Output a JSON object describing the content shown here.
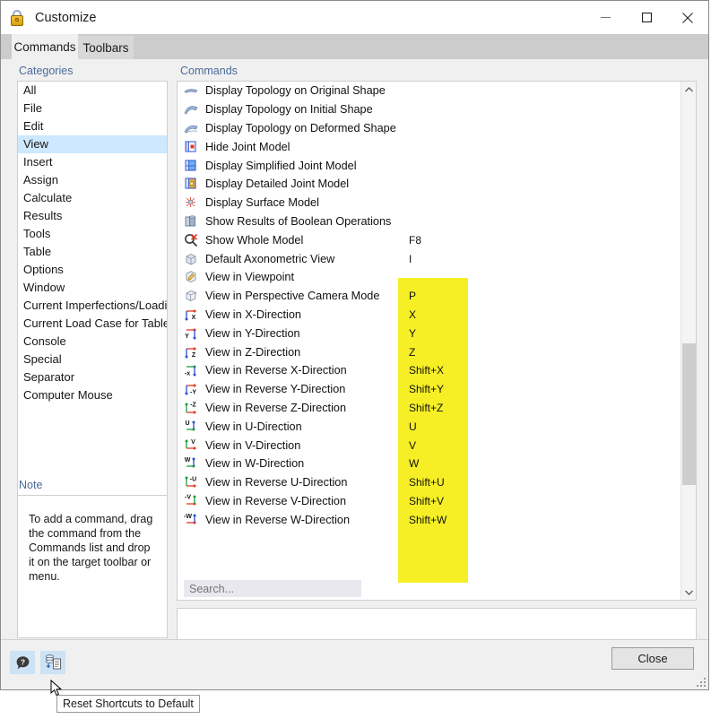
{
  "window": {
    "title": "Customize",
    "icon": "lock-icon",
    "minimize_label": "–",
    "maximize_label": "□",
    "close_label": "✕"
  },
  "tabs": [
    {
      "label": "Commands",
      "active": true
    },
    {
      "label": "Toolbars",
      "active": false
    }
  ],
  "categories": {
    "label": "Categories",
    "selected": "View",
    "items": [
      "All",
      "File",
      "Edit",
      "View",
      "Insert",
      "Assign",
      "Calculate",
      "Results",
      "Tools",
      "Table",
      "Options",
      "Window",
      "Current Imperfections/Loading",
      "Current Load Case for Tables",
      "Console",
      "Special",
      "Separator",
      "Computer Mouse"
    ]
  },
  "note": {
    "label": "Note",
    "text": "To add a command, drag the command from the Commands list and drop it on the target toolbar or menu."
  },
  "commands": {
    "label": "Commands",
    "items": [
      {
        "label": "Display Topology on Original Shape",
        "icon": "topology-original-icon",
        "shortcut": ""
      },
      {
        "label": "Display Topology on Initial Shape",
        "icon": "topology-initial-icon",
        "shortcut": ""
      },
      {
        "label": "Display Topology on Deformed Shape",
        "icon": "topology-deformed-icon",
        "shortcut": ""
      },
      {
        "label": "Hide Joint Model",
        "icon": "hide-joint-model-icon",
        "shortcut": ""
      },
      {
        "label": "Display Simplified Joint Model",
        "icon": "simplified-joint-model-icon",
        "shortcut": ""
      },
      {
        "label": "Display Detailed Joint Model",
        "icon": "detailed-joint-model-icon",
        "shortcut": ""
      },
      {
        "label": "Display Surface Model",
        "icon": "surface-model-icon",
        "shortcut": ""
      },
      {
        "label": "Show Results of Boolean Operations",
        "icon": "boolean-operations-icon",
        "shortcut": ""
      },
      {
        "label": "Show Whole Model",
        "icon": "show-whole-model-icon",
        "shortcut": "F8"
      },
      {
        "label": "Default Axonometric View",
        "icon": "axonometric-view-icon",
        "shortcut": "I"
      },
      {
        "label": "View in Viewpoint",
        "icon": "viewpoint-icon",
        "shortcut": ""
      },
      {
        "label": "View in Perspective Camera Mode",
        "icon": "perspective-camera-icon",
        "shortcut": "P"
      },
      {
        "label": "View in X-Direction",
        "icon": "view-x-direction-icon",
        "shortcut": "X"
      },
      {
        "label": "View in Y-Direction",
        "icon": "view-y-direction-icon",
        "shortcut": "Y"
      },
      {
        "label": "View in Z-Direction",
        "icon": "view-z-direction-icon",
        "shortcut": "Z"
      },
      {
        "label": "View in Reverse X-Direction",
        "icon": "view-reverse-x-icon",
        "shortcut": "Shift+X"
      },
      {
        "label": "View in Reverse Y-Direction",
        "icon": "view-reverse-y-icon",
        "shortcut": "Shift+Y"
      },
      {
        "label": "View in Reverse Z-Direction",
        "icon": "view-reverse-z-icon",
        "shortcut": "Shift+Z"
      },
      {
        "label": "View in U-Direction",
        "icon": "view-u-direction-icon",
        "shortcut": "U"
      },
      {
        "label": "View in V-Direction",
        "icon": "view-v-direction-icon",
        "shortcut": "V"
      },
      {
        "label": "View in W-Direction",
        "icon": "view-w-direction-icon",
        "shortcut": "W"
      },
      {
        "label": "View in Reverse U-Direction",
        "icon": "view-reverse-u-icon",
        "shortcut": "Shift+U"
      },
      {
        "label": "View in Reverse V-Direction",
        "icon": "view-reverse-v-icon",
        "shortcut": "Shift+V"
      },
      {
        "label": "View in Reverse W-Direction",
        "icon": "view-reverse-w-icon",
        "shortcut": "Shift+W"
      }
    ]
  },
  "search": {
    "placeholder": "Search...",
    "value": ""
  },
  "footer": {
    "help_icon": "help-icon",
    "reset_icon": "reset-shortcuts-icon",
    "close_label": "Close"
  },
  "tooltip": {
    "text": "Reset Shortcuts to Default"
  },
  "colors": {
    "highlight_yellow": "#f6ef26",
    "selection_blue": "#cde8ff",
    "panel_label_blue": "#4a6a9a",
    "toolbutton_blue": "#cce2f5"
  }
}
